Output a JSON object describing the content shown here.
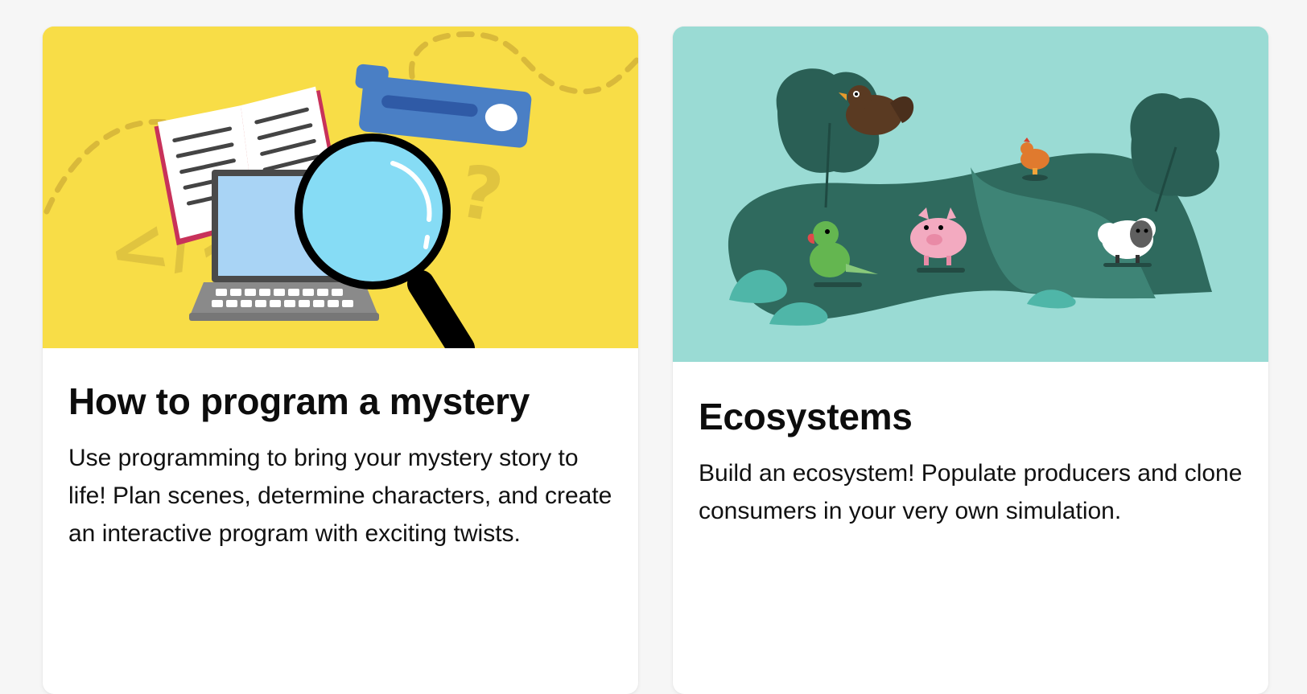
{
  "cards": [
    {
      "title": "How to program a mystery",
      "description": "Use programming to bring your mystery story to life! Plan scenes, determine characters, and create an interactive program with exciting twists.",
      "illustration_bg": "#f8dd47",
      "illustration": [
        "open-book-icon",
        "laptop-icon",
        "magnifying-glass-icon",
        "code-tag-icon",
        "question-mark-icon",
        "slider-block-icon"
      ]
    },
    {
      "title": "Ecosystems",
      "description": "Build an ecosystem! Populate producers and clone consumers in your very own simulation.",
      "illustration_bg": "#9adbd4",
      "illustration": [
        "tree-icon",
        "bird-icon",
        "parrot-icon",
        "pig-icon",
        "hen-icon",
        "sheep-icon"
      ]
    }
  ]
}
